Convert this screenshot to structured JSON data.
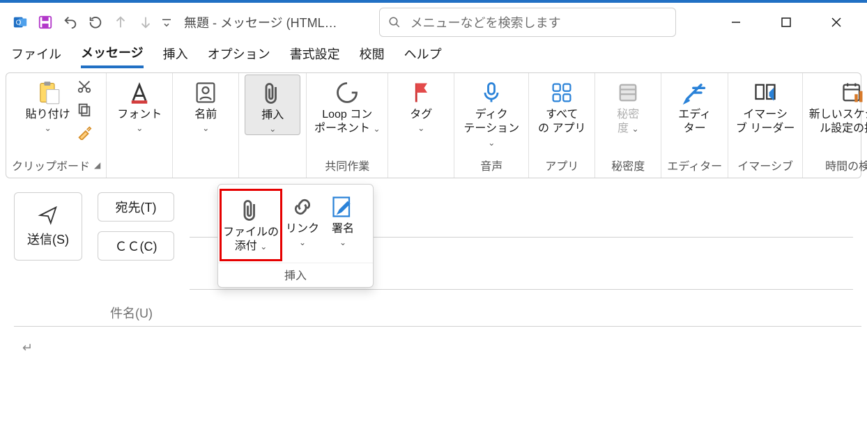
{
  "titlebar": {
    "title": "無題  -  メッセージ (HTML…"
  },
  "search": {
    "placeholder": "メニューなどを検索します"
  },
  "tabs": {
    "file": "ファイル",
    "message": "メッセージ",
    "insert": "挿入",
    "options": "オプション",
    "format": "書式設定",
    "review": "校閲",
    "help": "ヘルプ"
  },
  "ribbon": {
    "paste": "貼り付け",
    "clipboard_group": "クリップボード",
    "font": "フォント",
    "names": "名前",
    "insert": "挿入",
    "loop_l1": "Loop コン",
    "loop_l2": "ポーネント",
    "collab_group": "共同作業",
    "tag": "タグ",
    "dictation_l1": "ディク",
    "dictation_l2": "テーション",
    "voice_group": "音声",
    "allapps_l1": "すべて",
    "allapps_l2": "の アプリ",
    "apps_group": "アプリ",
    "sensitivity_l1": "秘密",
    "sensitivity_l2": "度",
    "sensitivity_group": "秘密度",
    "editor_l1": "エディ",
    "editor_l2": "ター",
    "editor_group": "エディター",
    "immersive_l1": "イマーシ",
    "immersive_l2": "ブ リーダー",
    "immersive_group": "イマーシブ",
    "schedule_l1": "新しいスケジュー",
    "schedule_l2": "ル設定の投票",
    "findtime_group": "時間の検索"
  },
  "flyout": {
    "attach_l1": "ファイルの",
    "attach_l2": "添付",
    "link": "リンク",
    "signature": "署名",
    "group": "挿入"
  },
  "compose": {
    "send": "送信(S)",
    "to": "宛先(T)",
    "cc": "ＣＣ(C)",
    "subject_label": "件名(U)",
    "body_marker": "↵"
  }
}
